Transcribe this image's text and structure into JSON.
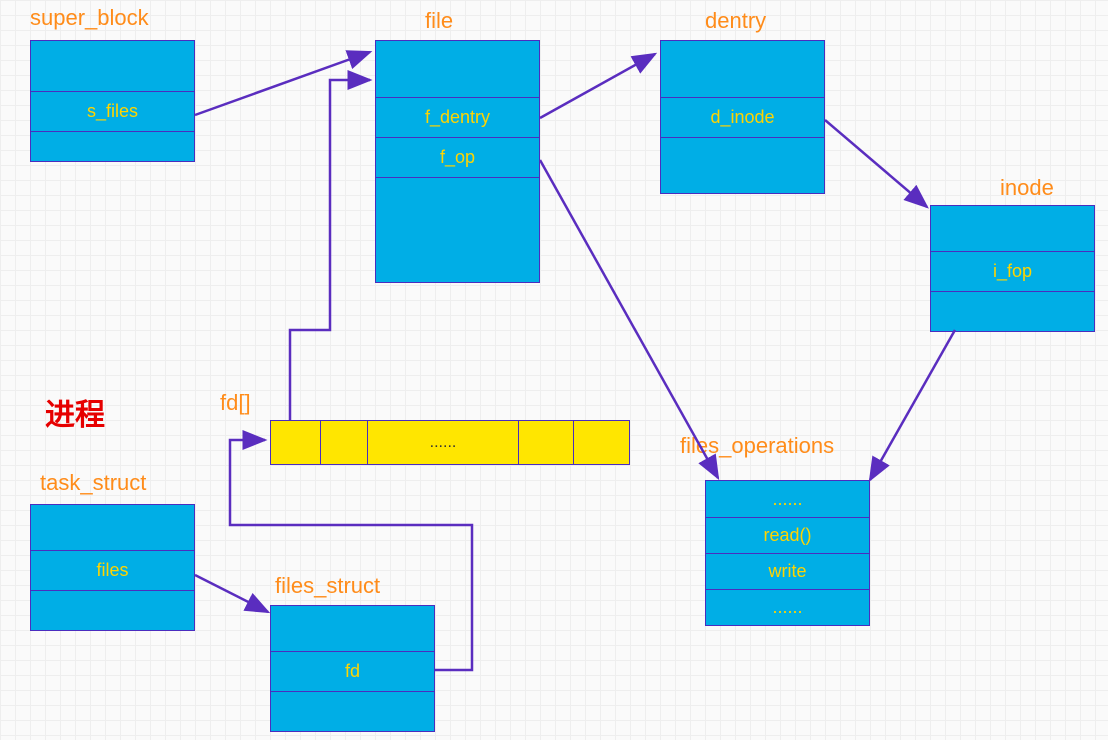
{
  "labels": {
    "super_block": "super_block",
    "file": "file",
    "dentry": "dentry",
    "inode": "inode",
    "process": "进程",
    "fd_array": "fd[]",
    "task_struct": "task_struct",
    "files_struct": "files_struct",
    "files_operations": "files_operations"
  },
  "boxes": {
    "super_block": {
      "fields": [
        "s_files"
      ]
    },
    "file": {
      "fields": [
        "f_dentry",
        "f_op"
      ]
    },
    "dentry": {
      "fields": [
        "d_inode"
      ]
    },
    "inode": {
      "fields": [
        "i_fop"
      ]
    },
    "task_struct": {
      "fields": [
        "files"
      ]
    },
    "files_struct": {
      "fields": [
        "fd"
      ]
    },
    "files_operations": {
      "fields": [
        "......",
        "read()",
        "write",
        "......"
      ]
    }
  },
  "fd_array": {
    "cells": [
      "",
      "",
      "......",
      "",
      ""
    ],
    "center_text": "......"
  }
}
